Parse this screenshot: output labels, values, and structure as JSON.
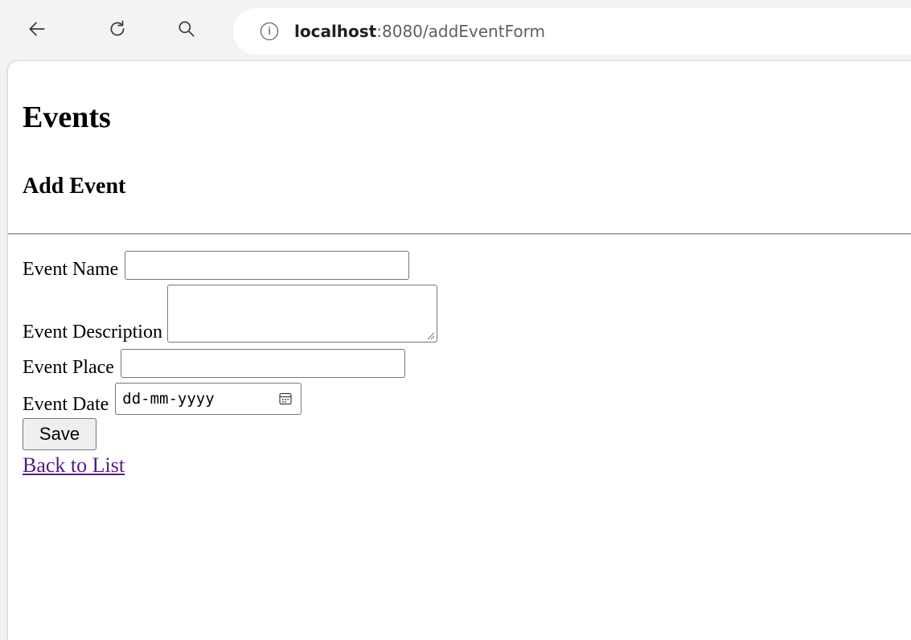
{
  "browser": {
    "url_host": "localhost",
    "url_path": ":8080/addEventForm",
    "back_icon": "arrow-left-icon",
    "reload_icon": "reload-icon",
    "search_icon": "search-icon",
    "info_icon": "info-icon",
    "info_glyph": "i"
  },
  "page": {
    "title": "Events",
    "subtitle": "Add Event"
  },
  "form": {
    "event_name_label": "Event Name",
    "event_name_value": "",
    "event_description_label": "Event Description",
    "event_description_value": "",
    "event_place_label": "Event Place",
    "event_place_value": "",
    "event_date_label": "Event Date",
    "event_date_placeholder": "dd-mm-yyyy",
    "calendar_icon": "calendar-icon",
    "save_label": "Save"
  },
  "links": {
    "back_to_list": "Back to List"
  },
  "colors": {
    "link_visited": "#551a8b",
    "page_bg": "#ffffff",
    "chrome_bg": "#f3f3f3"
  }
}
